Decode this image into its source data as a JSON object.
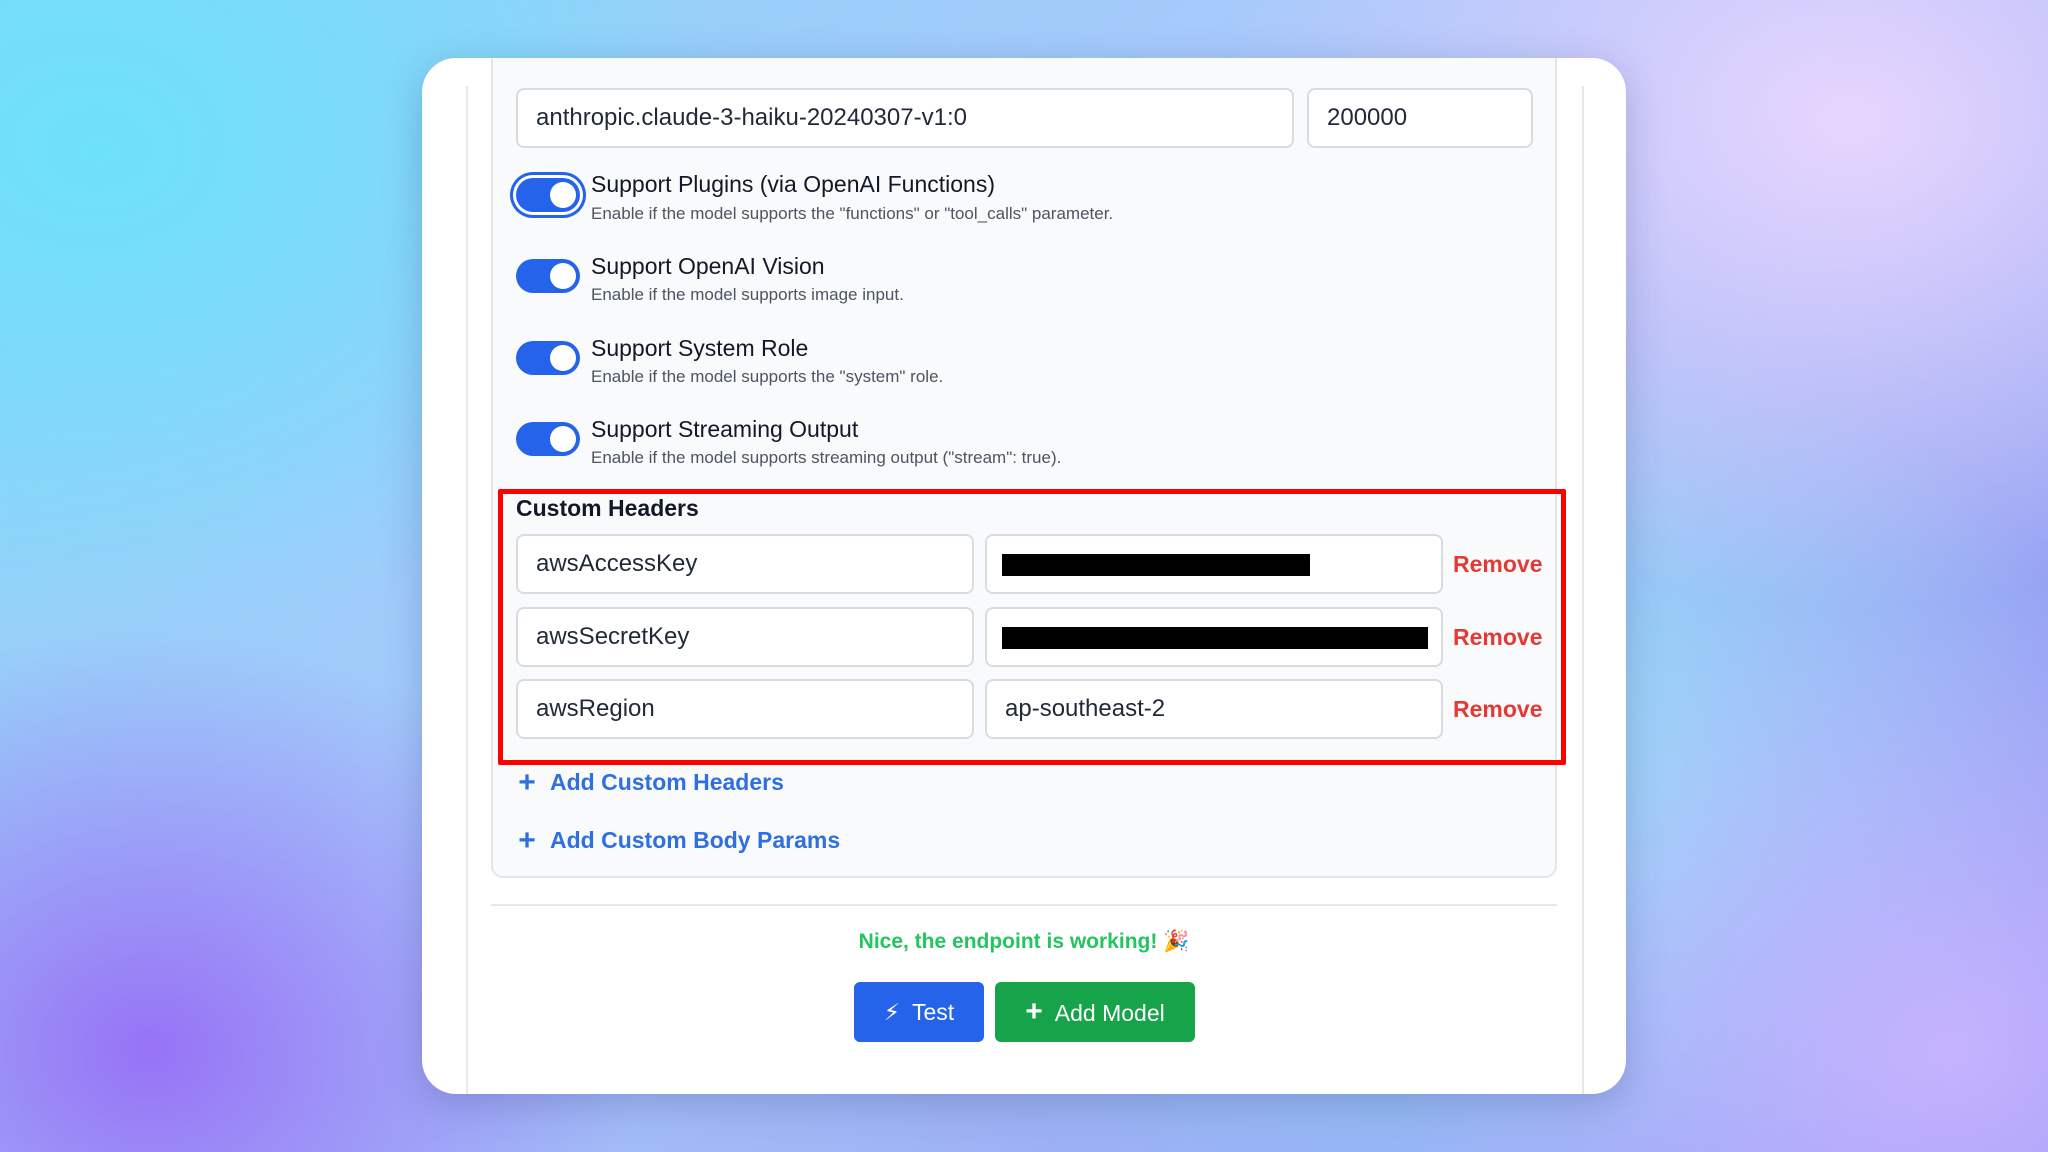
{
  "model": {
    "name_value": "anthropic.claude-3-haiku-20240307-v1:0",
    "context_value": "200000"
  },
  "toggles": [
    {
      "title": "Support Plugins (via OpenAI Functions)",
      "description": "Enable if the model supports the \"functions\" or \"tool_calls\" parameter.",
      "enabled": true
    },
    {
      "title": "Support OpenAI Vision",
      "description": "Enable if the model supports image input.",
      "enabled": true
    },
    {
      "title": "Support System Role",
      "description": "Enable if the model supports the \"system\" role.",
      "enabled": true
    },
    {
      "title": "Support Streaming Output",
      "description": "Enable if the model supports streaming output (\"stream\": true).",
      "enabled": true
    }
  ],
  "custom_headers": {
    "title": "Custom Headers",
    "rows": [
      {
        "key": "awsAccessKey",
        "value": "",
        "redacted": true,
        "remove_label": "Remove"
      },
      {
        "key": "awsSecretKey",
        "value": "",
        "redacted": true,
        "remove_label": "Remove"
      },
      {
        "key": "awsRegion",
        "value": "ap-southeast-2",
        "redacted": false,
        "remove_label": "Remove"
      }
    ],
    "add_label": "Add Custom Headers"
  },
  "body_params": {
    "add_label": "Add Custom Body Params"
  },
  "status": {
    "message": "Nice, the endpoint is working! 🎉",
    "color": "#22c55e"
  },
  "actions": {
    "test_icon": "⚡",
    "test_label": "Test",
    "add_icon": "+",
    "add_label": "Add Model"
  },
  "colors": {
    "accent": "#2563eb",
    "success": "#16a34a",
    "danger": "#e53935",
    "highlight": "#ff0000"
  }
}
